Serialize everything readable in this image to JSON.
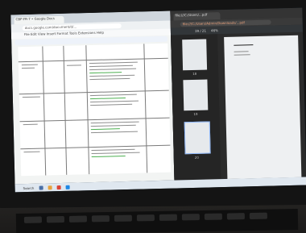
{
  "left_window": {
    "tab_title": "CBP-FR-7 • Google Docs",
    "address": "docs.google.com/document/d/...",
    "menu": "File  Edit  View  Insert  Format  Tools  Extensions  Help"
  },
  "right_window": {
    "tab_title": "file:///C:/Users/...pdf",
    "address": "file:///C:/Users/Admin/Downloads/...pdf",
    "page_counter": "19 / 21",
    "zoom": "46%",
    "thumb_numbers": [
      "18",
      "19",
      "20"
    ]
  },
  "taskbar": {
    "search_label": "Search"
  }
}
